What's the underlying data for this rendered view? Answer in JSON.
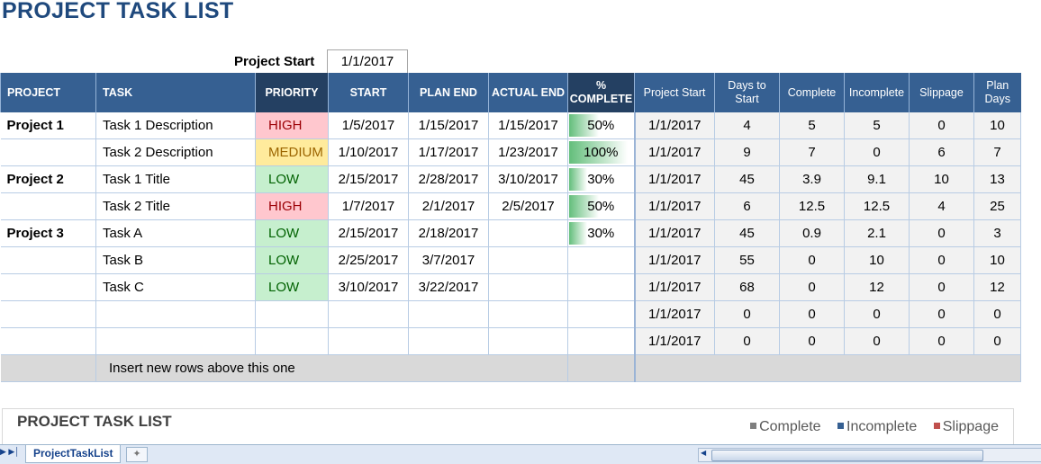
{
  "title": "PROJECT TASK LIST",
  "project_start_label": "Project Start",
  "project_start_value": "1/1/2017",
  "headers": {
    "project": "PROJECT",
    "task": "TASK",
    "priority": "PRIORITY",
    "start": "START",
    "plan_end": "PLAN END",
    "actual_end": "ACTUAL END",
    "pct_line1": "%",
    "pct_line2": "COMPLETE",
    "project_start": "Project Start",
    "days_line1": "Days to",
    "days_line2": "Start",
    "complete": "Complete",
    "incomplete": "Incomplete",
    "slippage": "Slippage",
    "plan_line1": "Plan",
    "plan_line2": "Days"
  },
  "rows": [
    {
      "project": "Project 1",
      "task": "Task 1 Description",
      "priority": "HIGH",
      "start": "1/5/2017",
      "plan_end": "1/15/2017",
      "actual_end": "1/15/2017",
      "pct": "50%",
      "pct_value": 0.5,
      "ps": "1/1/2017",
      "days": "4",
      "complete": "5",
      "incomplete": "5",
      "slippage": "0",
      "plan_days": "10"
    },
    {
      "project": "",
      "task": "Task 2 Description",
      "priority": "MEDIUM",
      "start": "1/10/2017",
      "plan_end": "1/17/2017",
      "actual_end": "1/23/2017",
      "pct": "100%",
      "pct_value": 1.0,
      "ps": "1/1/2017",
      "days": "9",
      "complete": "7",
      "incomplete": "0",
      "slippage": "6",
      "plan_days": "7"
    },
    {
      "project": "Project 2",
      "task": "Task 1 Title",
      "priority": "LOW",
      "start": "2/15/2017",
      "plan_end": "2/28/2017",
      "actual_end": "3/10/2017",
      "pct": "30%",
      "pct_value": 0.3,
      "ps": "1/1/2017",
      "days": "45",
      "complete": "3.9",
      "incomplete": "9.1",
      "slippage": "10",
      "plan_days": "13"
    },
    {
      "project": "",
      "task": "Task 2 Title",
      "priority": "HIGH",
      "start": "1/7/2017",
      "plan_end": "2/1/2017",
      "actual_end": "2/5/2017",
      "pct": "50%",
      "pct_value": 0.5,
      "ps": "1/1/2017",
      "days": "6",
      "complete": "12.5",
      "incomplete": "12.5",
      "slippage": "4",
      "plan_days": "25"
    },
    {
      "project": "Project 3",
      "task": "Task A",
      "priority": "LOW",
      "start": "2/15/2017",
      "plan_end": "2/18/2017",
      "actual_end": "",
      "pct": "30%",
      "pct_value": 0.3,
      "ps": "1/1/2017",
      "days": "45",
      "complete": "0.9",
      "incomplete": "2.1",
      "slippage": "0",
      "plan_days": "3"
    },
    {
      "project": "",
      "task": "Task B",
      "priority": "LOW",
      "start": "2/25/2017",
      "plan_end": "3/7/2017",
      "actual_end": "",
      "pct": "",
      "pct_value": 0,
      "ps": "1/1/2017",
      "days": "55",
      "complete": "0",
      "incomplete": "10",
      "slippage": "0",
      "plan_days": "10"
    },
    {
      "project": "",
      "task": "Task C",
      "priority": "LOW",
      "start": "3/10/2017",
      "plan_end": "3/22/2017",
      "actual_end": "",
      "pct": "",
      "pct_value": 0,
      "ps": "1/1/2017",
      "days": "68",
      "complete": "0",
      "incomplete": "12",
      "slippage": "0",
      "plan_days": "12"
    },
    {
      "project": "",
      "task": "",
      "priority": "",
      "start": "",
      "plan_end": "",
      "actual_end": "",
      "pct": "",
      "pct_value": 0,
      "ps": "1/1/2017",
      "days": "0",
      "complete": "0",
      "incomplete": "0",
      "slippage": "0",
      "plan_days": "0"
    },
    {
      "project": "",
      "task": "",
      "priority": "",
      "start": "",
      "plan_end": "",
      "actual_end": "",
      "pct": "",
      "pct_value": 0,
      "ps": "1/1/2017",
      "days": "0",
      "complete": "0",
      "incomplete": "0",
      "slippage": "0",
      "plan_days": "0"
    }
  ],
  "footer_text": "Insert new rows above this one",
  "chart": {
    "title": "PROJECT TASK LIST",
    "legend": [
      {
        "label": "Complete",
        "color": "#7f7f7f"
      },
      {
        "label": "Incomplete",
        "color": "#366092"
      },
      {
        "label": "Slippage",
        "color": "#c0504d"
      }
    ]
  },
  "sheet_tab": "ProjectTaskList"
}
